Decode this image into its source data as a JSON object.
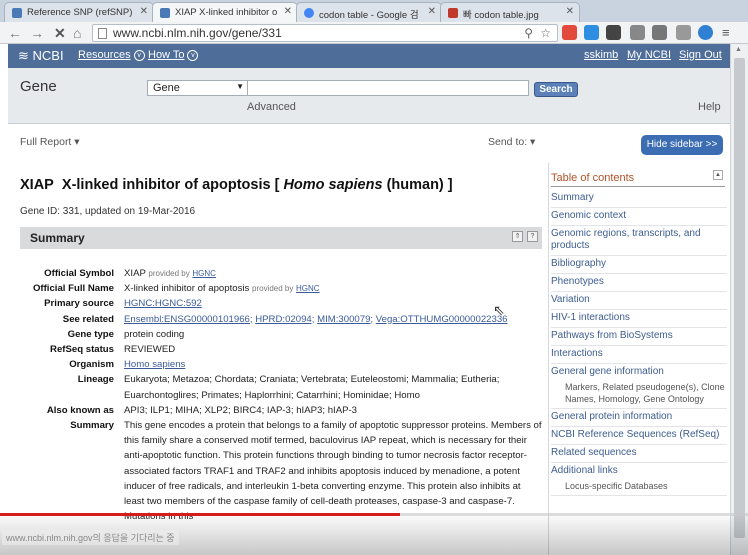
{
  "browser": {
    "tabs": [
      {
        "label": "Reference SNP (refSNP)",
        "fav": "#4a7ab5"
      },
      {
        "label": "XIAP X-linked inhibitor o",
        "fav": "#4a7ab5"
      },
      {
        "label": "codon table - Google 검",
        "fav": "#4285f4"
      },
      {
        "label": "빠 codon table.jpg",
        "fav": "#c0392b"
      }
    ],
    "url": "www.ncbi.nlm.nih.gov/gene/331",
    "ext_colors": [
      "#e24a3b",
      "#2d8de0",
      "#444",
      "#888",
      "#777",
      "#999",
      "#2f7fd3",
      "#555"
    ]
  },
  "ncbi": {
    "logo": "NCBI",
    "resources": "Resources",
    "howto": "How To",
    "user": "sskimb",
    "myncbi": "My NCBI",
    "signout": "Sign Out"
  },
  "search": {
    "db_label": "Gene",
    "db_value": "Gene",
    "button": "Search",
    "advanced": "Advanced",
    "help": "Help"
  },
  "report": {
    "full_report": "Full Report",
    "send_to": "Send to:",
    "hide_sidebar": "Hide sidebar >>",
    "title_symbol": "XIAP",
    "title_name": "X-linked inhibitor of apoptosis [",
    "title_species": "Homo sapiens",
    "title_tail": "(human) ]",
    "gene_id": "Gene ID: 331, updated on 19-Mar-2016",
    "summary_header": "Summary"
  },
  "fields": {
    "official_symbol": {
      "k": "Official Symbol",
      "v": "XIAP",
      "provided": "provided by",
      "src": "HGNC"
    },
    "official_name": {
      "k": "Official Full Name",
      "v": "X-linked inhibitor of apoptosis",
      "provided": "provided by",
      "src": "HGNC"
    },
    "primary_source": {
      "k": "Primary source",
      "v": "HGNC:HGNC:592"
    },
    "see_also": {
      "k": "See related",
      "links": [
        "Ensembl:ENSG00000101966;",
        "HPRD:02094;",
        "MIM:300079;",
        "Vega:OTTHUMG00000022336"
      ]
    },
    "gene_type": {
      "k": "Gene type",
      "v": "protein coding"
    },
    "refseq": {
      "k": "RefSeq status",
      "v": "REVIEWED"
    },
    "organism": {
      "k": "Organism",
      "v": "Homo sapiens"
    },
    "lineage": {
      "k": "Lineage",
      "v": "Eukaryota; Metazoa; Chordata; Craniata; Vertebrata; Euteleostomi; Mammalia; Eutheria; Euarchontoglires; Primates; Haplorrhini; Catarrhini; Hominidae; Homo"
    },
    "aka": {
      "k": "Also known as",
      "v": "API3; ILP1; MIHA; XLP2; BIRC4; IAP-3; hIAP3; hIAP-3"
    },
    "summary": {
      "k": "Summary",
      "v": "This gene encodes a protein that belongs to a family of apoptotic suppressor proteins. Members of this family share a conserved motif termed, baculovirus IAP repeat, which is necessary for their anti-apoptotic function. This protein functions through binding to tumor necrosis factor receptor-associated factors TRAF1 and TRAF2 and inhibits apoptosis induced by menadione, a potent inducer of free radicals, and interleukin 1-beta converting enzyme. This protein also inhibits at least two members of the caspase family of cell-death proteases, caspase-3 and caspase-7. Mutations in this"
    }
  },
  "toc": {
    "heading": "Table of contents",
    "items": [
      "Summary",
      "Genomic context",
      "Genomic regions, transcripts, and products",
      "Bibliography",
      "Phenotypes",
      "Variation",
      "HIV-1 interactions",
      "Pathways from BioSystems",
      "Interactions",
      "General gene information",
      "General protein information",
      "NCBI Reference Sequences (RefSeq)",
      "Related sequences",
      "Additional links"
    ],
    "gene_info_sub": "Markers, Related pseudogene(s), Clone Names, Homology, Gene Ontology",
    "additional_sub": "Locus-specific Databases"
  },
  "status": "www.ncbi.nlm.nih.gov의 응답을 기다리는 중"
}
